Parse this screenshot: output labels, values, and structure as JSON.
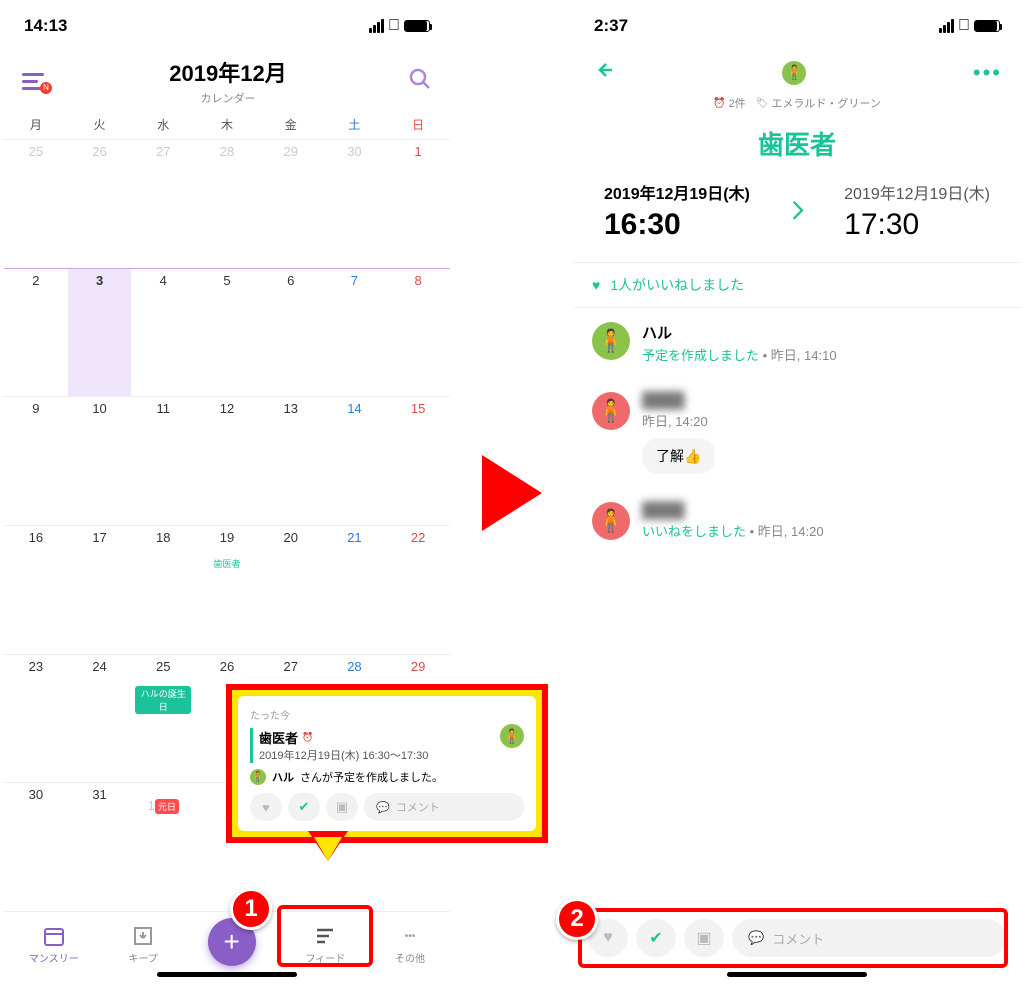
{
  "left": {
    "status_time": "14:13",
    "header_title": "2019年12月",
    "header_sub": "カレンダー",
    "burger_badge": "N",
    "weekdays": [
      "月",
      "火",
      "水",
      "木",
      "金",
      "土",
      "日"
    ],
    "rows": [
      [
        {
          "n": "25",
          "cls": "dim"
        },
        {
          "n": "26",
          "cls": "dim"
        },
        {
          "n": "27",
          "cls": "dim"
        },
        {
          "n": "28",
          "cls": "dim"
        },
        {
          "n": "29",
          "cls": "dim"
        },
        {
          "n": "30",
          "cls": "dim"
        },
        {
          "n": "1",
          "cls": "sun"
        }
      ],
      [
        {
          "n": "2"
        },
        {
          "n": "3",
          "cls": "today"
        },
        {
          "n": "4"
        },
        {
          "n": "5"
        },
        {
          "n": "6"
        },
        {
          "n": "7",
          "cls": "sat"
        },
        {
          "n": "8",
          "cls": "sun"
        }
      ],
      [
        {
          "n": "9"
        },
        {
          "n": "10"
        },
        {
          "n": "11"
        },
        {
          "n": "12"
        },
        {
          "n": "13"
        },
        {
          "n": "14",
          "cls": "sat"
        },
        {
          "n": "15",
          "cls": "sun"
        }
      ],
      [
        {
          "n": "16"
        },
        {
          "n": "17"
        },
        {
          "n": "18"
        },
        {
          "n": "19",
          "ev": "歯医者"
        },
        {
          "n": "20"
        },
        {
          "n": "21",
          "cls": "sat"
        },
        {
          "n": "22",
          "cls": "sun"
        }
      ],
      [
        {
          "n": "23"
        },
        {
          "n": "24"
        },
        {
          "n": "25",
          "pill": "ハルの誕生日",
          "pillcls": "green"
        },
        {
          "n": "26"
        },
        {
          "n": "27"
        },
        {
          "n": "28",
          "cls": "sat"
        },
        {
          "n": "29",
          "cls": "sun"
        }
      ],
      [
        {
          "n": "30"
        },
        {
          "n": "31"
        },
        {
          "n": "1",
          "cls": "dim",
          "pill": "元日",
          "pillcls": "red"
        },
        {
          "n": "",
          "cls": "dim"
        },
        {
          "n": "",
          "cls": "dim"
        },
        {
          "n": "",
          "cls": "dim"
        },
        {
          "n": "",
          "cls": "dim"
        }
      ]
    ],
    "tabs": {
      "monthly": "マンスリー",
      "keep": "キープ",
      "feed": "フィード",
      "other": "その他"
    },
    "popup": {
      "time": "たった今",
      "title": "歯医者",
      "date": "2019年12月19日(木) 16:30〜17:30",
      "msg_user": "ハル",
      "msg_text": "さんが予定を作成しました。",
      "comment_ph": "コメント"
    }
  },
  "right": {
    "status_time": "2:37",
    "meta_count": "2件",
    "meta_tag": "エメラルド・グリーン",
    "title": "歯医者",
    "start_date": "2019年12月19日(木)",
    "start_time": "16:30",
    "end_date": "2019年12月19日(木)",
    "end_time": "17:30",
    "likes": "1人がいいねしました",
    "act1_name": "ハル",
    "act1_msg": "予定を作成しました",
    "act1_time": "昨日, 14:10",
    "act2_name": "████",
    "act2_time": "昨日, 14:20",
    "act2_bubble": "了解👍",
    "act3_name": "████",
    "act3_msg": "いいねをしました",
    "act3_time": "昨日, 14:20",
    "comment_ph": "コメント"
  },
  "callout": {
    "n1": "1",
    "n2": "2"
  }
}
